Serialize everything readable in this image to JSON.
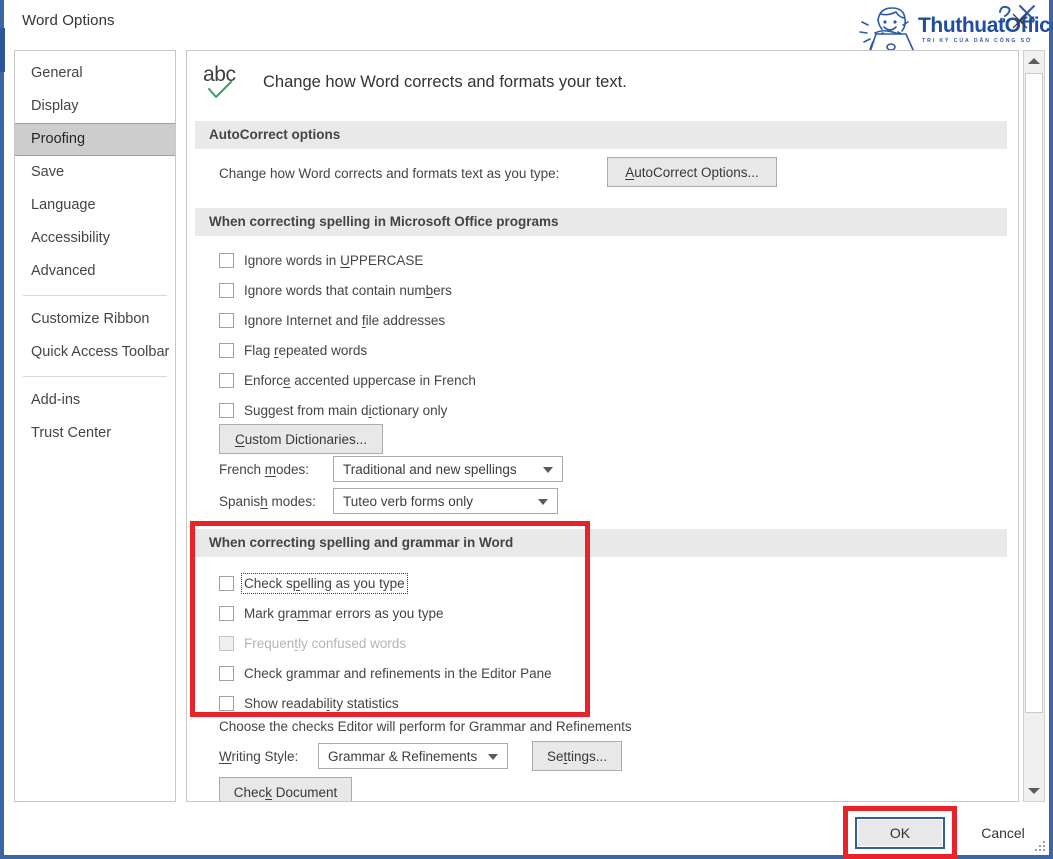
{
  "window": {
    "title": "Word Options",
    "close_icon": "close-icon"
  },
  "watermark": {
    "brand": "ThuthuatOffice",
    "tagline": "TRI KỶ CỦA DÂN CÔNG SỞ"
  },
  "sidebar": {
    "items": [
      {
        "label": "General",
        "active": false
      },
      {
        "label": "Display",
        "active": false
      },
      {
        "label": "Proofing",
        "active": true
      },
      {
        "label": "Save",
        "active": false
      },
      {
        "label": "Language",
        "active": false
      },
      {
        "label": "Accessibility",
        "active": false
      },
      {
        "label": "Advanced",
        "active": false
      },
      {
        "label": "Customize Ribbon",
        "active": false
      },
      {
        "label": "Quick Access Toolbar",
        "active": false
      },
      {
        "label": "Add-ins",
        "active": false
      },
      {
        "label": "Trust Center",
        "active": false
      }
    ]
  },
  "hero": {
    "icon": "abc-spellcheck-icon",
    "text": "Change how Word corrects and formats your text."
  },
  "autocorrect": {
    "section_title": "AutoCorrect options",
    "description": "Change how Word corrects and formats text as you type:",
    "button_label": "AutoCorrect Options..."
  },
  "office_spelling": {
    "section_title": "When correcting spelling in Microsoft Office programs",
    "checkboxes": [
      {
        "label": "Ignore words in UPPERCASE",
        "checked": false,
        "disabled": false
      },
      {
        "label": "Ignore words that contain numbers",
        "checked": false,
        "disabled": false
      },
      {
        "label": "Ignore Internet and file addresses",
        "checked": false,
        "disabled": false
      },
      {
        "label": "Flag repeated words",
        "checked": false,
        "disabled": false
      },
      {
        "label": "Enforce accented uppercase in French",
        "checked": false,
        "disabled": false
      },
      {
        "label": "Suggest from main dictionary only",
        "checked": false,
        "disabled": false
      }
    ],
    "custom_dictionaries_label": "Custom Dictionaries...",
    "french_modes_label": "French modes:",
    "french_modes_value": "Traditional and new spellings",
    "spanish_modes_label": "Spanish modes:",
    "spanish_modes_value": "Tuteo verb forms only"
  },
  "word_grammar": {
    "section_title": "When correcting spelling and grammar in Word",
    "highlighted": true,
    "checkboxes": [
      {
        "label": "Check spelling as you type",
        "checked": false,
        "disabled": false,
        "focused": true
      },
      {
        "label": "Mark grammar errors as you type",
        "checked": false,
        "disabled": false,
        "focused": false
      },
      {
        "label": "Frequently confused words",
        "checked": false,
        "disabled": true,
        "focused": false
      },
      {
        "label": "Check grammar and refinements in the Editor Pane",
        "checked": false,
        "disabled": false,
        "focused": false
      },
      {
        "label": "Show readability statistics",
        "checked": false,
        "disabled": false,
        "focused": false
      }
    ],
    "choose_text": "Choose the checks Editor will perform for Grammar and Refinements",
    "writing_style_label": "Writing Style:",
    "writing_style_value": "Grammar & Refinements",
    "settings_label": "Settings...",
    "check_document_label": "Check Document"
  },
  "footer": {
    "ok_label": "OK",
    "cancel_label": "Cancel"
  },
  "colors": {
    "highlight_red": "#e8232a",
    "focus_blue": "#2f5f9e",
    "active_sidebar": "#cdcdcd",
    "section_header": "#e9e9e9",
    "brand_blue": "#1f4ea1"
  }
}
